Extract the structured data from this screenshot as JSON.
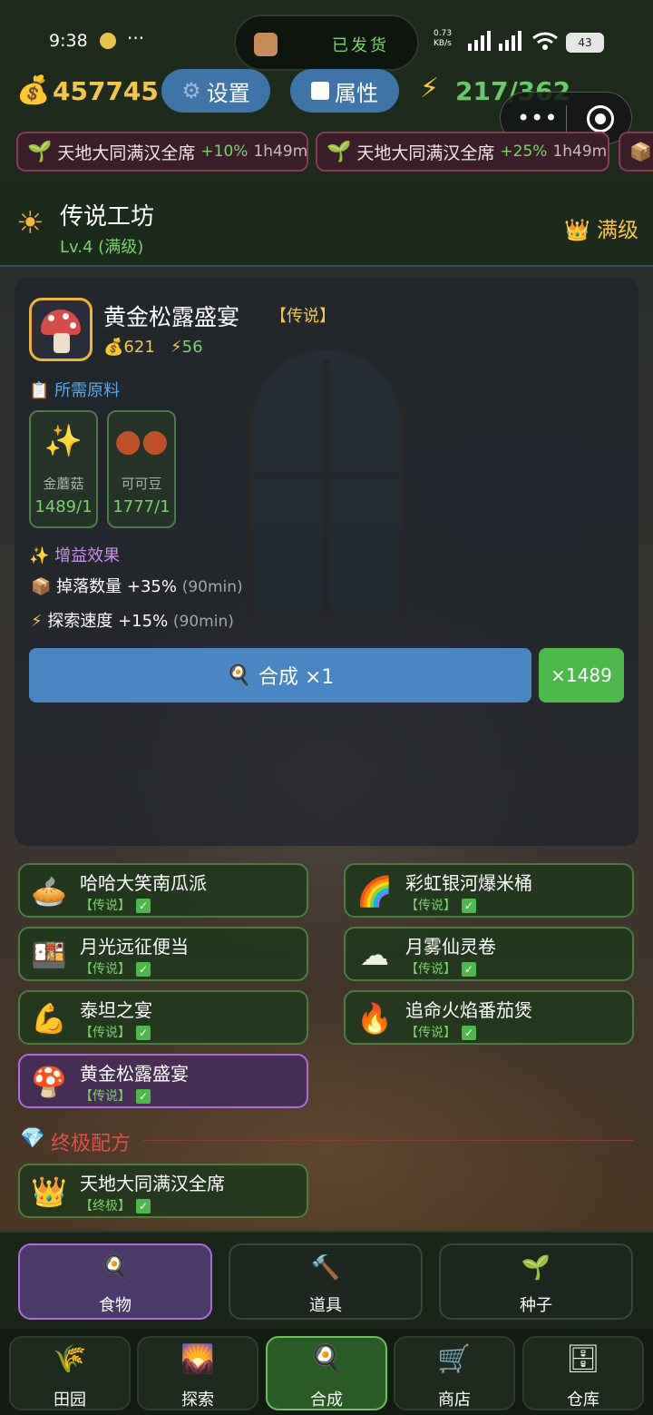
{
  "status_bar": {
    "time": "9:38",
    "dots": "···",
    "pill_text": "已发货",
    "net_speed": "0.73 KB/s",
    "battery": "43"
  },
  "hud": {
    "coins": "457745",
    "settings_label": "设置",
    "attributes_label": "属性",
    "energy": "217/362"
  },
  "buffs": [
    {
      "name": "天地大同满汉全席",
      "pct": "+10%",
      "duration": "1h49m"
    },
    {
      "name": "天地大同满汉全席",
      "pct": "+25%",
      "duration": "1h49m"
    }
  ],
  "workshop": {
    "title": "传说工坊",
    "level": "Lv.4 (满级)",
    "max_label": "满级"
  },
  "recipe": {
    "name": "黄金松露盛宴",
    "tag": "【传说】",
    "cost": "621",
    "energy": "56",
    "materials_label": "所需原料",
    "materials": [
      {
        "name": "金蘑菇",
        "qty": "1489/1",
        "icon": "sparkles-icon"
      },
      {
        "name": "可可豆",
        "qty": "1777/1",
        "icon": "beans-icon"
      }
    ],
    "effects_label": "增益效果",
    "effects": [
      {
        "label": "掉落数量 +35%",
        "duration": "(90min)",
        "icon": "box-icon"
      },
      {
        "label": "探索速度 +15%",
        "duration": "(90min)",
        "icon": "lightning-icon"
      }
    ],
    "craft_label": "合成 ×1",
    "craft_max_label": "×1489"
  },
  "recipe_list": [
    {
      "name": "哈哈大笑南瓜派",
      "tag": "【传说】",
      "icon": "pie-icon"
    },
    {
      "name": "彩虹银河爆米桶",
      "tag": "【传说】",
      "icon": "rainbow-icon"
    },
    {
      "name": "月光远征便当",
      "tag": "【传说】",
      "icon": "bento-icon"
    },
    {
      "name": "月雾仙灵卷",
      "tag": "【传说】",
      "icon": "cloud-icon"
    },
    {
      "name": "泰坦之宴",
      "tag": "【传说】",
      "icon": "muscle-icon"
    },
    {
      "name": "追命火焰番茄煲",
      "tag": "【传说】",
      "icon": "fire-icon"
    },
    {
      "name": "黄金松露盛宴",
      "tag": "【传说】",
      "icon": "mushroom-icon"
    }
  ],
  "ultimate": {
    "label": "终极配方",
    "items": [
      {
        "name": "天地大同满汉全席",
        "tag": "【终极】",
        "icon": "crown-icon"
      }
    ]
  },
  "categories": [
    {
      "label": "食物",
      "icon": "frying-pan-icon",
      "active": true
    },
    {
      "label": "道具",
      "icon": "hammer-icon",
      "active": false
    },
    {
      "label": "种子",
      "icon": "sprout-icon",
      "active": false
    }
  ],
  "nav": [
    {
      "label": "田园",
      "icon": "wheat-icon"
    },
    {
      "label": "探索",
      "icon": "landscape-icon"
    },
    {
      "label": "合成",
      "icon": "frying-pan-icon",
      "active": true
    },
    {
      "label": "商店",
      "icon": "cart-icon"
    },
    {
      "label": "仓库",
      "icon": "cabinet-icon"
    }
  ],
  "colors": {
    "gold": "#f3c54a",
    "green": "#7bd16b",
    "blue_button": "#4a86c4",
    "selected_purple": "#b06ad8",
    "ultimate_red": "#e0504a"
  }
}
